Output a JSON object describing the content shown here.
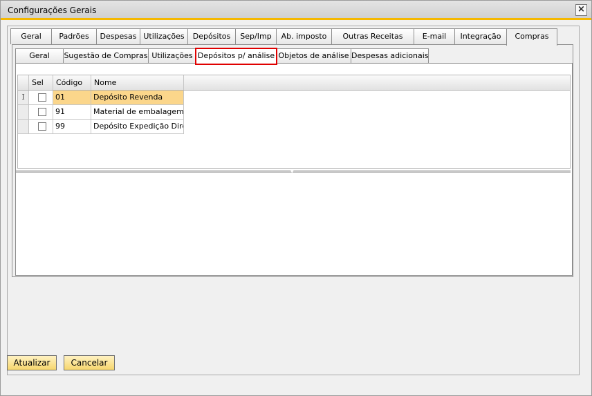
{
  "window": {
    "title": "Configurações Gerais",
    "close_glyph": "×"
  },
  "tabs": [
    {
      "label": "Geral"
    },
    {
      "label": "Padrões"
    },
    {
      "label": "Despesas"
    },
    {
      "label": "Utilizações"
    },
    {
      "label": "Depósitos"
    },
    {
      "label": "Sep/Imp"
    },
    {
      "label": "Ab. imposto"
    },
    {
      "label": "Outras Receitas"
    },
    {
      "label": "E-mail"
    },
    {
      "label": "Integração"
    },
    {
      "label": "Compras"
    }
  ],
  "active_tab": "Compras",
  "subtabs": [
    {
      "label": "Geral"
    },
    {
      "label": "Sugestão de Compras"
    },
    {
      "label": "Utilizações"
    },
    {
      "label": "Depósitos p/ análise"
    },
    {
      "label": "Objetos de análise"
    },
    {
      "label": "Despesas adicionais"
    }
  ],
  "active_subtab": "Depósitos p/ análise",
  "highlight_color": "#e00000",
  "selection_color": "#fbd68b",
  "table": {
    "columns": {
      "sel": "Sel",
      "code": "Código",
      "name": "Nome"
    },
    "rows": [
      {
        "code": "01",
        "name": "Depósito Revenda",
        "selected": true,
        "row_marker": "I"
      },
      {
        "code": "91",
        "name": "Material de embalagem",
        "selected": false
      },
      {
        "code": "99",
        "name": "Depósito Expedição Direto",
        "selected": false
      }
    ]
  },
  "buttons": {
    "update": "Atualizar",
    "cancel": "Cancelar"
  }
}
